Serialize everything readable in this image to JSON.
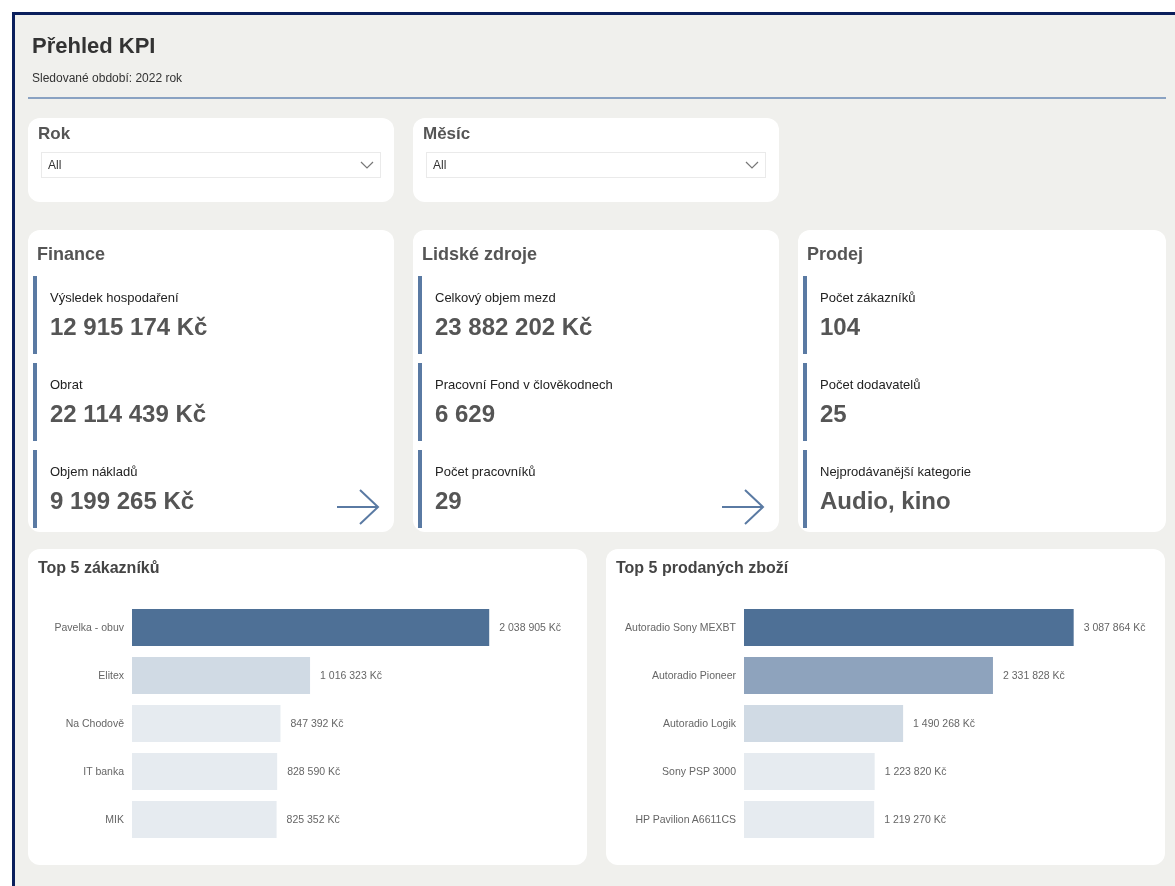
{
  "header": {
    "title": "Přehled KPI",
    "subtitle": "Sledované období: 2022 rok"
  },
  "filters": [
    {
      "label": "Rok",
      "value": "All"
    },
    {
      "label": "Měsíc",
      "value": "All"
    }
  ],
  "kpi_cards": [
    {
      "title": "Finance",
      "has_arrow": true,
      "items": [
        {
          "label": "Výsledek hospodaření",
          "value": "12 915 174 Kč"
        },
        {
          "label": "Obrat",
          "value": "22 114 439 Kč"
        },
        {
          "label": "Objem nákladů",
          "value": "9 199 265 Kč"
        }
      ]
    },
    {
      "title": "Lidské zdroje",
      "has_arrow": true,
      "items": [
        {
          "label": "Celkový objem mezd",
          "value": "23 882 202 Kč"
        },
        {
          "label": "Pracovní Fond v člověkodnech",
          "value": "6 629"
        },
        {
          "label": "Počet pracovníků",
          "value": "29"
        }
      ]
    },
    {
      "title": "Prodej",
      "has_arrow": false,
      "items": [
        {
          "label": "Počet zákazníků",
          "value": "104"
        },
        {
          "label": "Počet dodavatelů",
          "value": "25"
        },
        {
          "label": "Nejprodávanější kategorie",
          "value": "Audio, kino"
        }
      ]
    }
  ],
  "charts": [
    {
      "chart_data": {
        "type": "bar",
        "orientation": "horizontal",
        "title": "Top 5 zákazníků",
        "categories": [
          "Pavelka - obuv",
          "Elitex",
          "Na Chodově",
          "IT banka",
          "MIK"
        ],
        "values": [
          2038905,
          1016323,
          847392,
          828590,
          825352
        ],
        "value_labels": [
          "2 038 905 Kč",
          "1 016 323 Kč",
          "847 392 Kč",
          "828 590 Kč",
          "825 352 Kč"
        ]
      }
    },
    {
      "chart_data": {
        "type": "bar",
        "orientation": "horizontal",
        "title": "Top 5 prodaných zboží",
        "categories": [
          "Autoradio Sony MEXBT",
          "Autoradio Pioneer",
          "Autoradio Logik",
          "Sony PSP 3000",
          "HP Pavilion A6611CS"
        ],
        "values": [
          3087864,
          2331828,
          1490268,
          1223820,
          1219270
        ],
        "value_labels": [
          "3 087 864 Kč",
          "2 331 828 Kč",
          "1 490 268 Kč",
          "1 223 820 Kč",
          "1 219 270 Kč"
        ]
      }
    }
  ]
}
